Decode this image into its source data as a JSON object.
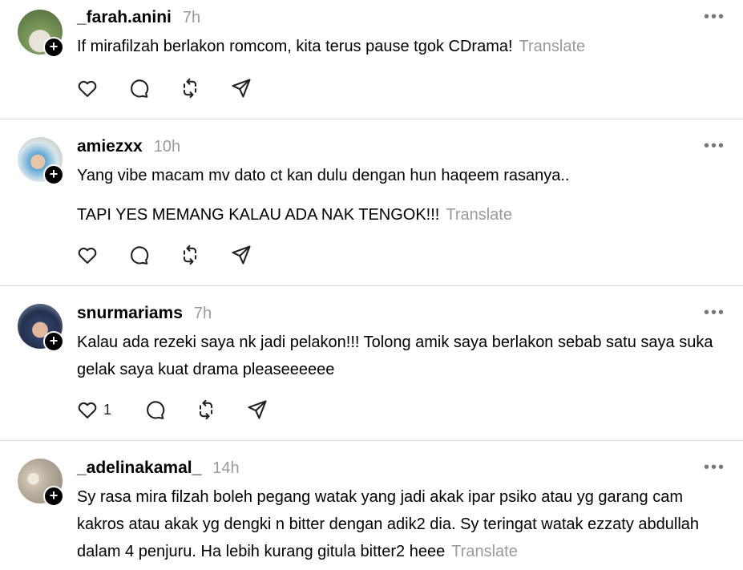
{
  "posts": [
    {
      "username": "_farah.anini",
      "time": "7h",
      "paragraphs": [
        "If mirafilzah berlakon romcom, kita terus pause tgok CDrama!"
      ],
      "translate": "Translate",
      "like_count": "",
      "avatar_colors": [
        "#6f8d52",
        "#c9c9a5"
      ]
    },
    {
      "username": "amiezxx",
      "time": "10h",
      "paragraphs": [
        "Yang vibe macam mv dato ct kan dulu dengan hun haqeem rasanya..",
        "TAPI YES MEMANG KALAU ADA NAK TENGOK!!!"
      ],
      "translate": "Translate",
      "like_count": "",
      "avatar_colors": [
        "#7fb6d9",
        "#e4d6c6"
      ]
    },
    {
      "username": "snurmariams",
      "time": "7h",
      "paragraphs": [
        "Kalau ada rezeki saya nk jadi pelakon!!! Tolong amik saya berlakon sebab satu saya suka gelak saya kuat drama pleaseeeeee"
      ],
      "translate": "",
      "like_count": "1",
      "avatar_colors": [
        "#2f3f63",
        "#d8b29a"
      ]
    },
    {
      "username": "_adelinakamal_",
      "time": "14h",
      "paragraphs": [
        "Sy rasa mira filzah boleh pegang watak yang jadi akak ipar psiko atau yg garang cam kakros atau akak yg dengki n bitter dengan adik2 dia. Sy teringat watak ezzaty abdullah dalam 4 penjuru. Ha lebih kurang gitula bitter2 heee"
      ],
      "translate": "Translate",
      "like_count": "",
      "avatar_colors": [
        "#cfc5b5",
        "#8f8778"
      ]
    }
  ],
  "icons": {
    "like": "heart-icon",
    "reply": "comment-icon",
    "repost": "repost-icon",
    "share": "send-icon",
    "more": "more-icon",
    "follow": "plus-icon"
  },
  "labels": {
    "more": "•••",
    "follow": "+"
  }
}
